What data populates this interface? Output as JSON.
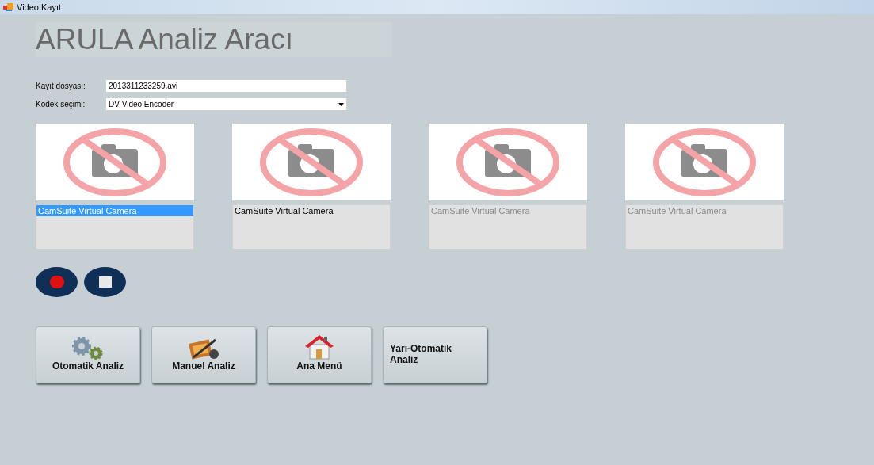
{
  "window": {
    "title": "Video Kayıt"
  },
  "heading": "ARULA Analiz Aracı",
  "fields": [
    {
      "kind": "text",
      "label": "Kayıt dosyası:",
      "value": "2013311233259.avi"
    },
    {
      "kind": "dropdown",
      "label": "Kodek seçimi:",
      "value": "DV Video Encoder"
    }
  ],
  "cameras": [
    {
      "device": "CamSuite Virtual Camera",
      "selected": true,
      "disabled": false
    },
    {
      "device": "CamSuite Virtual Camera",
      "selected": false,
      "disabled": false
    },
    {
      "device": "CamSuite Virtual Camera",
      "selected": false,
      "disabled": true
    },
    {
      "device": "CamSuite Virtual Camera",
      "selected": false,
      "disabled": true
    }
  ],
  "record_controls": [
    {
      "kind": "record"
    },
    {
      "kind": "stop"
    }
  ],
  "buttons": [
    {
      "kind": "gears",
      "label": "Otomatik Analiz"
    },
    {
      "kind": "film",
      "label": "Manuel Analiz"
    },
    {
      "kind": "house",
      "label": "Ana Menü"
    },
    {
      "kind": "plain",
      "label": "Yarı-Otomatik Analiz"
    }
  ]
}
